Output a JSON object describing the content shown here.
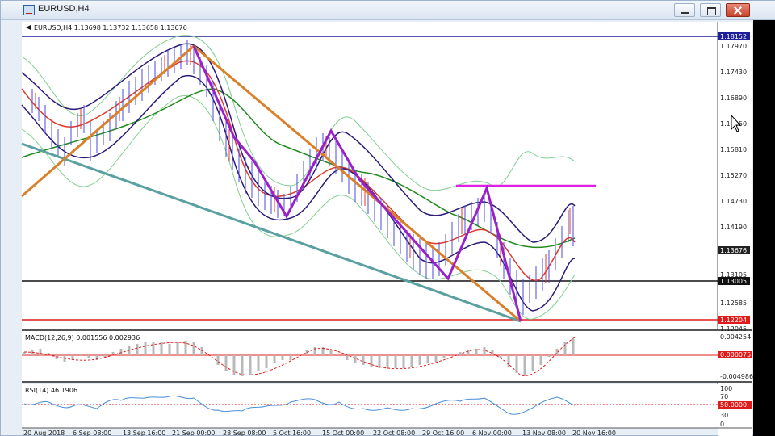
{
  "window": {
    "title": "EURUSD,H4",
    "icon": "chart-window-icon"
  },
  "chart": {
    "header": "EURUSD,H4  1.13698 1.13732 1.13658 1.13676",
    "price_labels": [
      "1.17970",
      "1.17430",
      "1.16890",
      "1.16350",
      "1.15810",
      "1.15270",
      "1.14730",
      "1.14190",
      "1.13105",
      "1.12585",
      "1.12045"
    ],
    "tagged_levels": [
      {
        "label": "1.18152",
        "color": "#1f1f9a"
      },
      {
        "label": "1.13676",
        "color": "#222222"
      },
      {
        "label": "1.13005",
        "color": "#111111"
      },
      {
        "label": "1.12204",
        "color": "#e01b1b"
      }
    ],
    "time_labels": [
      "20 Aug 2018",
      "6 Sep 08:00",
      "13 Sep 16:00",
      "21 Sep 00:00",
      "28 Sep 08:00",
      "5 Oct 16:00",
      "15 Oct 00:00",
      "22 Oct 08:00",
      "29 Oct 16:00",
      "6 Nov 00:00",
      "13 Nov 08:00",
      "20 Nov 16:00"
    ]
  },
  "macd": {
    "header": "MACD(12,26,9) 0.001556 0.002936",
    "labels": [
      "0.004254",
      "0.000075",
      "-0.004986"
    ]
  },
  "rsi": {
    "header": "RSI(14) 46.1906",
    "labels": [
      "100",
      "70",
      "50.0000",
      "30",
      "0"
    ]
  },
  "colors": {
    "resistance": "#1f1f9a",
    "support_black": "#111111",
    "support_red": "#e01b1b",
    "pattern": "#9b20c8",
    "channel_orange": "#d98028",
    "trend_teal": "#5aa0a0",
    "neckline": "#e020e0",
    "ma_green": "#1e8a1e",
    "ma_red": "#e03a2a",
    "bands": "#7fcf8f",
    "envelope": "#2b1a7a"
  }
}
